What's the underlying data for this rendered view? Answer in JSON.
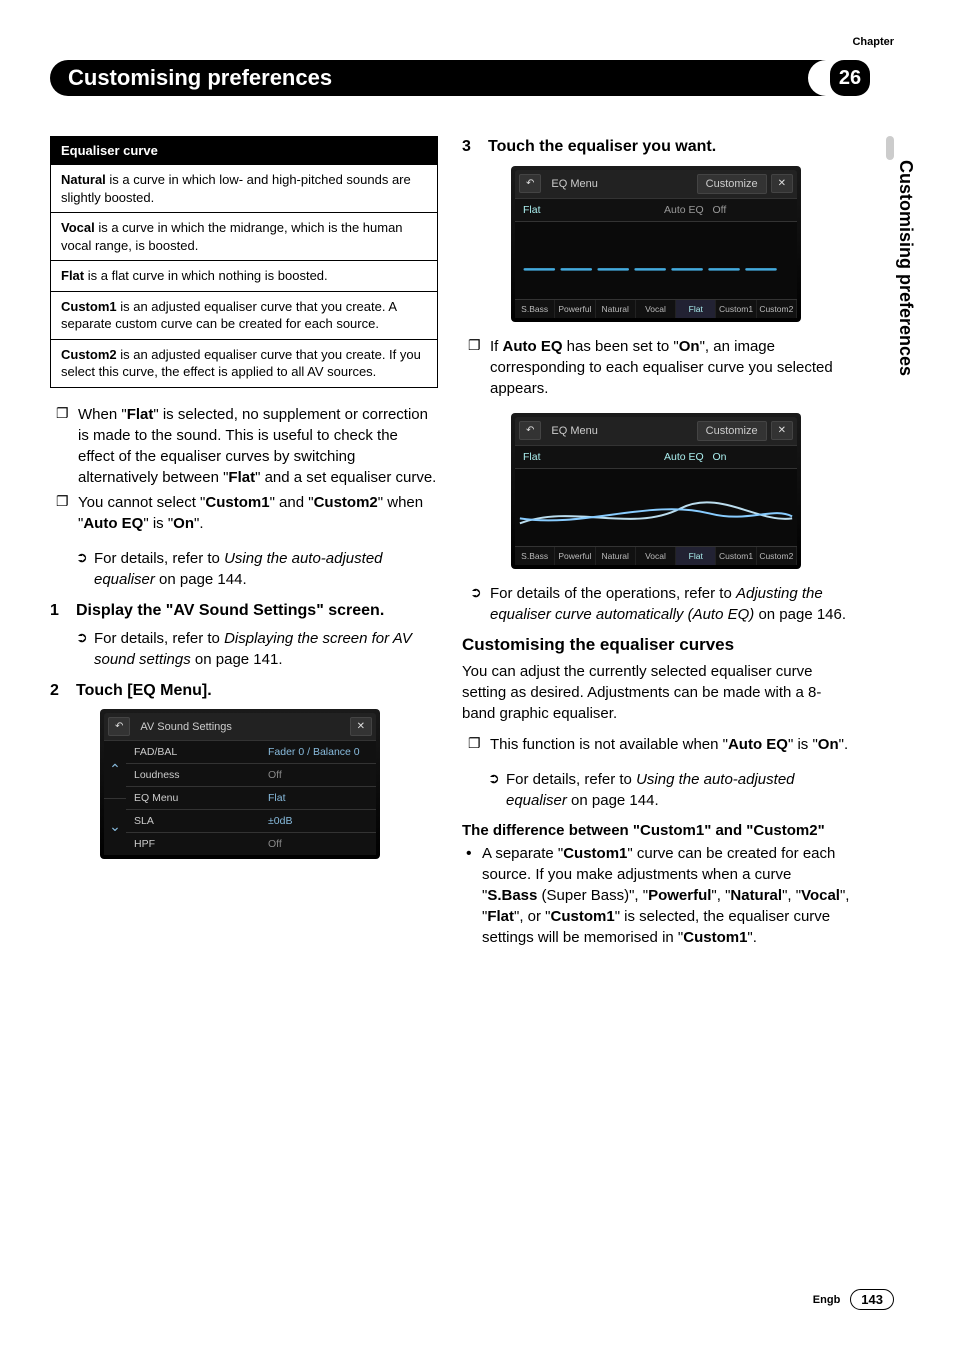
{
  "header": {
    "chapter_label": "Chapter",
    "chapter_number": "26",
    "title": "Customising preferences",
    "side_label": "Customising preferences"
  },
  "eq_table": {
    "header": "Equaliser curve",
    "rows": [
      {
        "bold": "Natural",
        "text": " is a curve in which low- and high-pitched sounds are slightly boosted."
      },
      {
        "bold": "Vocal",
        "text": " is a curve in which the midrange, which is the human vocal range, is boosted."
      },
      {
        "bold": "Flat",
        "text": " is a flat curve in which nothing is boosted."
      },
      {
        "bold": "Custom1",
        "text": " is an adjusted equaliser curve that you create. A separate custom curve can be created for each source."
      },
      {
        "bold": "Custom2",
        "text": " is an adjusted equaliser curve that you create. If you select this curve, the effect is applied to all AV sources."
      }
    ]
  },
  "left_notes": {
    "flat_note_pre": "When \"",
    "flat_note_b1": "Flat",
    "flat_note_mid": "\" is selected, no supplement or correction is made to the sound. This is useful to check the effect of the equaliser curves by switching alternatively between \"",
    "flat_note_b2": "Flat",
    "flat_note_end": "\" and a set equaliser curve.",
    "custom_note_pre": "You cannot select \"",
    "custom_note_b1": "Custom1",
    "custom_note_mid1": "\" and \"",
    "custom_note_b2": "Custom2",
    "custom_note_mid2": "\" when \"",
    "custom_note_b3": "Auto EQ",
    "custom_note_mid3": "\" is \"",
    "custom_note_b4": "On",
    "custom_note_end": "\".",
    "ref1_pre": "For details, refer to ",
    "ref1_it": "Using the auto-adjusted equaliser",
    "ref1_end": " on page 144."
  },
  "steps": {
    "s1_num": "1",
    "s1_text": "Display the \"AV Sound Settings\" screen.",
    "s1_ref_pre": "For details, refer to ",
    "s1_ref_it": "Displaying the screen for AV sound settings",
    "s1_ref_end": " on page 141.",
    "s2_num": "2",
    "s2_text": "Touch [EQ Menu].",
    "s3_num": "3",
    "s3_text": "Touch the equaliser you want."
  },
  "device1": {
    "title": "AV Sound Settings",
    "rows": [
      {
        "label": "FAD/BAL",
        "value": "Fader 0 / Balance 0",
        "dim": false
      },
      {
        "label": "Loudness",
        "value": "Off",
        "dim": true
      },
      {
        "label": "EQ Menu",
        "value": "Flat",
        "dim": false
      },
      {
        "label": "SLA",
        "value": "±0dB",
        "dim": false
      },
      {
        "label": "HPF",
        "value": "Off",
        "dim": true
      }
    ]
  },
  "device2": {
    "title": "EQ Menu",
    "customize": "Customize",
    "preset": "Flat",
    "auto_eq_label": "Auto EQ",
    "auto_eq_value": "Off",
    "tabs": [
      "S.Bass",
      "Powerful",
      "Natural",
      "Vocal",
      "Flat",
      "Custom1",
      "Custom2"
    ],
    "selected": 4
  },
  "device3": {
    "title": "EQ Menu",
    "customize": "Customize",
    "preset": "Flat",
    "auto_eq_label": "Auto EQ",
    "auto_eq_value": "On",
    "tabs": [
      "S.Bass",
      "Powerful",
      "Natural",
      "Vocal",
      "Flat",
      "Custom1",
      "Custom2"
    ],
    "selected": 4
  },
  "right": {
    "autoeq_note_pre": "If ",
    "autoeq_note_b1": "Auto EQ",
    "autoeq_note_mid1": " has been set to \"",
    "autoeq_note_b2": "On",
    "autoeq_note_end": "\", an image corresponding to each equaliser curve you selected appears.",
    "ref2_pre": "For details of the operations, refer to ",
    "ref2_it": "Adjusting the equaliser curve automatically (Auto EQ)",
    "ref2_end": " on page 146.",
    "heading": "Customising the equaliser curves",
    "para": "You can adjust the currently selected equaliser curve setting as desired. Adjustments can be made with a 8-band graphic equaliser.",
    "func_note_pre": "This function is not available when \"",
    "func_note_b1": "Auto EQ",
    "func_note_mid": "\" is \"",
    "func_note_b2": "On",
    "func_note_end": "\".",
    "ref3_pre": "For details, refer to ",
    "ref3_it": "Using the auto-adjusted equaliser",
    "ref3_end": " on page 144.",
    "diff_heading_pre": "The difference between \"",
    "diff_heading_b1": "Custom1",
    "diff_heading_mid": "\" and \"",
    "diff_heading_b2": "Custom2",
    "diff_heading_end": "\"",
    "bullet_pre": "A separate \"",
    "bullet_b1": "Custom1",
    "bullet_mid1": "\" curve can be created for each source. If you make adjustments when a curve \"",
    "bullet_b2": "S.Bass",
    "bullet_mid2": " (Super Bass)\", \"",
    "bullet_b3": "Powerful",
    "bullet_mid3": "\", \"",
    "bullet_b4": "Natural",
    "bullet_mid4": "\", \"",
    "bullet_b5": "Vocal",
    "bullet_mid5": "\", \"",
    "bullet_b6": "Flat",
    "bullet_mid6": "\", or \"",
    "bullet_b7": "Custom1",
    "bullet_mid7": "\" is selected, the equaliser curve settings will be memorised in \"",
    "bullet_b8": "Custom1",
    "bullet_end": "\"."
  },
  "footer": {
    "lang": "Engb",
    "page": "143"
  }
}
